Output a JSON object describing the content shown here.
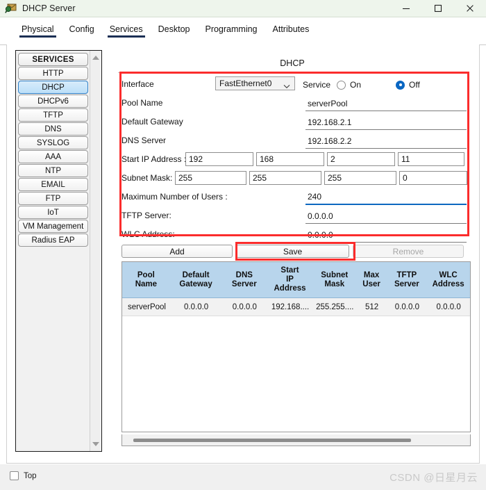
{
  "window": {
    "title": "DHCP Server",
    "app_icon": "dhcp-server-icon",
    "controls": {
      "minimize": "minimize-icon",
      "maximize": "maximize-icon",
      "close": "close-icon"
    }
  },
  "tabs": [
    {
      "label": "Physical",
      "active": true
    },
    {
      "label": "Config",
      "active": false
    },
    {
      "label": "Services",
      "active": true
    },
    {
      "label": "Desktop",
      "active": false
    },
    {
      "label": "Programming",
      "active": false
    },
    {
      "label": "Attributes",
      "active": false
    }
  ],
  "sidebar": {
    "header": "SERVICES",
    "items": [
      {
        "label": "HTTP",
        "selected": false
      },
      {
        "label": "DHCP",
        "selected": true
      },
      {
        "label": "DHCPv6",
        "selected": false
      },
      {
        "label": "TFTP",
        "selected": false
      },
      {
        "label": "DNS",
        "selected": false
      },
      {
        "label": "SYSLOG",
        "selected": false
      },
      {
        "label": "AAA",
        "selected": false
      },
      {
        "label": "NTP",
        "selected": false
      },
      {
        "label": "EMAIL",
        "selected": false
      },
      {
        "label": "FTP",
        "selected": false
      },
      {
        "label": "IoT",
        "selected": false
      },
      {
        "label": "VM Management",
        "selected": false
      },
      {
        "label": "Radius EAP",
        "selected": false
      }
    ]
  },
  "panel": {
    "title": "DHCP",
    "fields": {
      "interface_label": "Interface",
      "interface_value": "FastEthernet0",
      "service_label": "Service",
      "service_on_label": "On",
      "service_off_label": "Off",
      "service_state": "Off",
      "pool_name_label": "Pool Name",
      "pool_name_value": "serverPool",
      "default_gateway_label": "Default Gateway",
      "default_gateway_value": "192.168.2.1",
      "dns_server_label": "DNS Server",
      "dns_server_value": "192.168.2.2",
      "start_ip_label": "Start IP Address :",
      "start_ip_octets": [
        "192",
        "168",
        "2",
        "11"
      ],
      "subnet_mask_label": "Subnet Mask:",
      "subnet_mask_octets": [
        "255",
        "255",
        "255",
        "0"
      ],
      "max_users_label": "Maximum Number of Users :",
      "max_users_value": "240",
      "tftp_server_label": "TFTP Server:",
      "tftp_server_value": "0.0.0.0",
      "wlc_address_label": "WLC Address:",
      "wlc_address_value": "0.0.0.0"
    },
    "buttons": {
      "add": "Add",
      "save": "Save",
      "remove": "Remove"
    }
  },
  "table": {
    "columns": [
      "Pool\nName",
      "Default\nGateway",
      "DNS\nServer",
      "Start\nIP\nAddress",
      "Subnet\nMask",
      "Max\nUser",
      "TFTP\nServer",
      "WLC\nAddress"
    ],
    "rows": [
      {
        "pool_name": "serverPool",
        "default_gateway": "0.0.0.0",
        "dns_server": "0.0.0.0",
        "start_ip_address": "192.168....",
        "subnet_mask": "255.255....",
        "max_user": "512",
        "tftp_server": "0.0.0.0",
        "wlc_address": "0.0.0.0"
      }
    ]
  },
  "footer": {
    "top_checkbox_label": "Top",
    "top_checked": false,
    "watermark": "CSDN @日星月云"
  },
  "colors": {
    "accent_blue": "#0a66c2",
    "annotation_red": "#fb2c2c",
    "table_header": "#b8d5ec",
    "titlebar": "#eef5ec",
    "tab_underline": "#1b2f54"
  }
}
